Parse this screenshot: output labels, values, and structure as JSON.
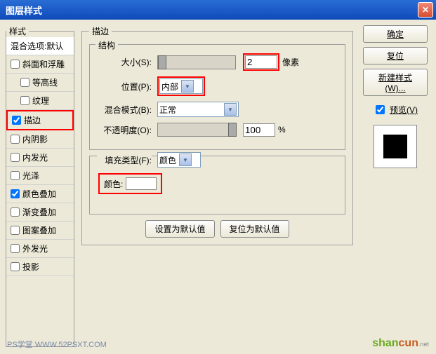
{
  "title": "图层样式",
  "styles": {
    "header": "样式",
    "blend": "混合选项:默认",
    "items": [
      {
        "label": "斜面和浮雕",
        "checked": false
      },
      {
        "label": "等高线",
        "checked": false,
        "indent": true
      },
      {
        "label": "纹理",
        "checked": false,
        "indent": true
      },
      {
        "label": "描边",
        "checked": true,
        "highlight": true
      },
      {
        "label": "内阴影",
        "checked": false
      },
      {
        "label": "内发光",
        "checked": false
      },
      {
        "label": "光泽",
        "checked": false
      },
      {
        "label": "颜色叠加",
        "checked": true
      },
      {
        "label": "渐变叠加",
        "checked": false
      },
      {
        "label": "图案叠加",
        "checked": false
      },
      {
        "label": "外发光",
        "checked": false
      },
      {
        "label": "投影",
        "checked": false
      }
    ]
  },
  "stroke": {
    "panel_title": "描边",
    "structure": "结构",
    "size_label": "大小(S):",
    "size_value": "2",
    "size_unit": "像素",
    "position_label": "位置(P):",
    "position_value": "内部",
    "blend_label": "混合模式(B):",
    "blend_value": "正常",
    "opacity_label": "不透明度(O):",
    "opacity_value": "100",
    "opacity_unit": "%",
    "fill_label": "填充类型(F):",
    "fill_value": "颜色",
    "color_label": "颜色:",
    "defaults_set": "设置为默认值",
    "defaults_reset": "复位为默认值"
  },
  "buttons": {
    "ok": "确定",
    "cancel": "复位",
    "new_style": "新建样式(W)...",
    "preview": "预览(V)"
  },
  "watermark1": "PS学堂  WWW.52PSXT.COM",
  "watermark2_a": "shan",
  "watermark2_b": "cun",
  "watermark2_c": ".net"
}
